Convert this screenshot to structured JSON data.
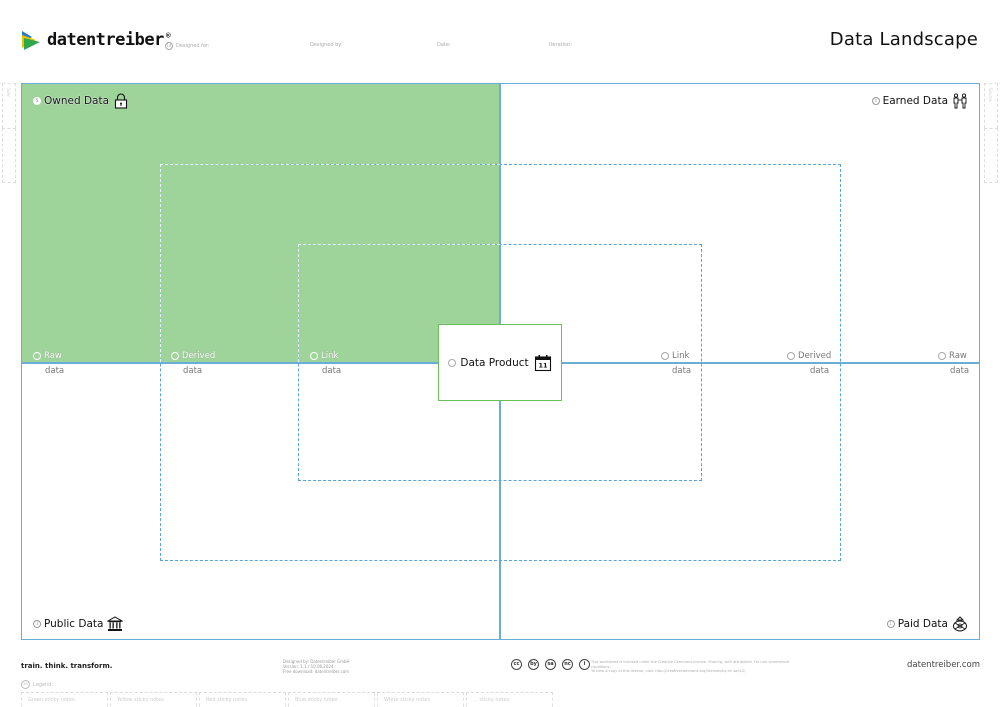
{
  "header": {
    "brand": "datentreiber",
    "brand_mark": "®",
    "title": "Data Landscape",
    "fields": [
      {
        "num": "14",
        "label": "Designed for:"
      },
      {
        "num": "",
        "label": "Designed by:"
      },
      {
        "num": "",
        "label": "Date:"
      },
      {
        "num": "",
        "label": "Iteration:"
      }
    ]
  },
  "quadrants": {
    "owned": {
      "num": "5",
      "label": "Owned Data",
      "icon": "padlock-icon"
    },
    "earned": {
      "num": "4",
      "label": "Earned Data",
      "icon": "people-holding-hands-icon"
    },
    "public": {
      "num": "3",
      "label": "Public Data",
      "icon": "public-building-icon"
    },
    "paid": {
      "num": "1",
      "label": "Paid Data",
      "icon": "money-bag-icon"
    }
  },
  "axis": {
    "left": [
      {
        "num": "6",
        "label": "Raw",
        "sub": "data"
      },
      {
        "num": "6",
        "label": "Derived",
        "sub": "data"
      },
      {
        "num": "6",
        "label": "Link",
        "sub": "data"
      }
    ],
    "right": [
      {
        "num": "6",
        "label": "Link",
        "sub": "data"
      },
      {
        "num": "6",
        "label": "Derived",
        "sub": "data"
      },
      {
        "num": "6",
        "label": "Raw",
        "sub": "data"
      }
    ]
  },
  "center": {
    "num": "7",
    "label": "Data Product",
    "icon": "calendar-icon",
    "icon_day": "11"
  },
  "side_labels": {
    "left": "Sale",
    "right": "Source"
  },
  "colors": {
    "owned_fill": "#9ed49a",
    "line_blue": "#6aaed6",
    "dash_blue": "#5aa3d8",
    "product_border": "#6cbf5f"
  },
  "footer": {
    "tagline": "train. think. transform.",
    "credits": [
      "Designed by: Datentreiber GmbH",
      "Version: 1.1 / 10.06.2024",
      "Free download: datentreiber.com"
    ],
    "license_icons": [
      "cc",
      "by",
      "sa",
      "nc",
      "i"
    ],
    "license_text": [
      "This worksheet is licensed under the Creative Commons license. Sharing, with attribution, for non-commercial conditions.",
      "To view a copy of this license, visit: http://creativecommons.org/licenses/by-nc-sa/4.0/"
    ],
    "site": "datentreiber.com",
    "legend": {
      "num": "15",
      "title": "Legend:",
      "items": [
        "Green sticky notes",
        "Yellow sticky notes",
        "Red sticky notes",
        "Blue sticky notes",
        "White sticky notes",
        "... sticky notes"
      ]
    }
  }
}
